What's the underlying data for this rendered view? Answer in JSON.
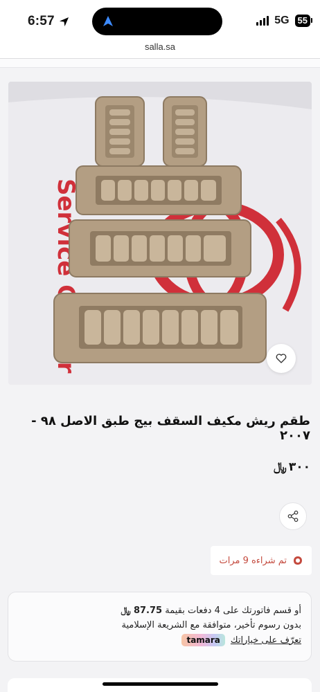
{
  "status_bar": {
    "time": "6:57",
    "network": "5G",
    "battery": "55"
  },
  "browser": {
    "url": "salla.sa"
  },
  "product": {
    "image_alt": "طقم ريش مكيف السقف بيج",
    "title": "طقم ريش مكيف السقف بيج طبق الاصل ٩٨ - ٢٠٠٧",
    "price_value": "٣٠٠",
    "currency_symbol": "﷼",
    "purchased_text": "تم شراءه 9 مرات",
    "purchased_count_icon": "digit-five-icon"
  },
  "tamara": {
    "line1_prefix": "أو قسم فاتورتك على 4 دفعات بقيمة",
    "installment_amount": "87.75",
    "currency_symbol": "﷼",
    "line2": "بدون رسوم تأخير، متوافقة مع الشريعة الإسلامية",
    "learn_more": "تعرّف على خياراتك",
    "logo_text": "tamara"
  },
  "colors": {
    "accent_red": "#c44a3e",
    "page_bg": "#f3f3f5",
    "card_bg": "#ffffff"
  },
  "icons": {
    "location": "location-arrow-icon",
    "wishlist": "heart-icon",
    "share": "share-icon"
  }
}
